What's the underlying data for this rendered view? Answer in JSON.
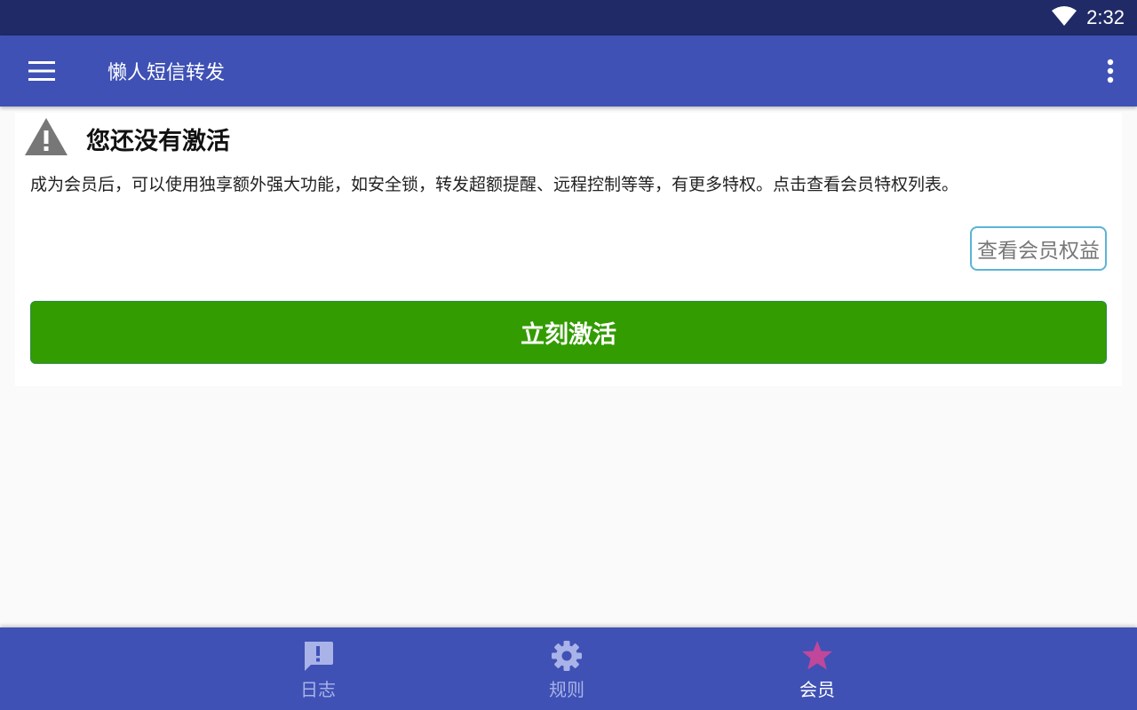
{
  "status_bar": {
    "time": "2:32",
    "wifi_icon": "wifi-icon"
  },
  "app_bar": {
    "menu_icon": "hamburger-menu-icon",
    "title": "懒人短信转发",
    "overflow_icon": "more-vert-icon"
  },
  "card": {
    "warning_icon": "warning-icon",
    "title": "您还没有激活",
    "description": "成为会员后，可以使用独享额外强大功能，如安全锁，转发超额提醒、远程控制等等，有更多特权。点击查看会员特权列表。",
    "benefits_button": "查看会员权益",
    "activate_button": "立刻激活"
  },
  "bottom_nav": {
    "items": [
      {
        "label": "日志",
        "icon": "log-message-icon",
        "active": false
      },
      {
        "label": "规则",
        "icon": "gear-icon",
        "active": false
      },
      {
        "label": "会员",
        "icon": "star-icon",
        "active": true
      }
    ]
  },
  "colors": {
    "primary": "#3f51b5",
    "status_bar": "#1f2a66",
    "activate_green": "#339c00",
    "active_star": "#c0479a",
    "inactive_nav": "#a9b3e8"
  }
}
